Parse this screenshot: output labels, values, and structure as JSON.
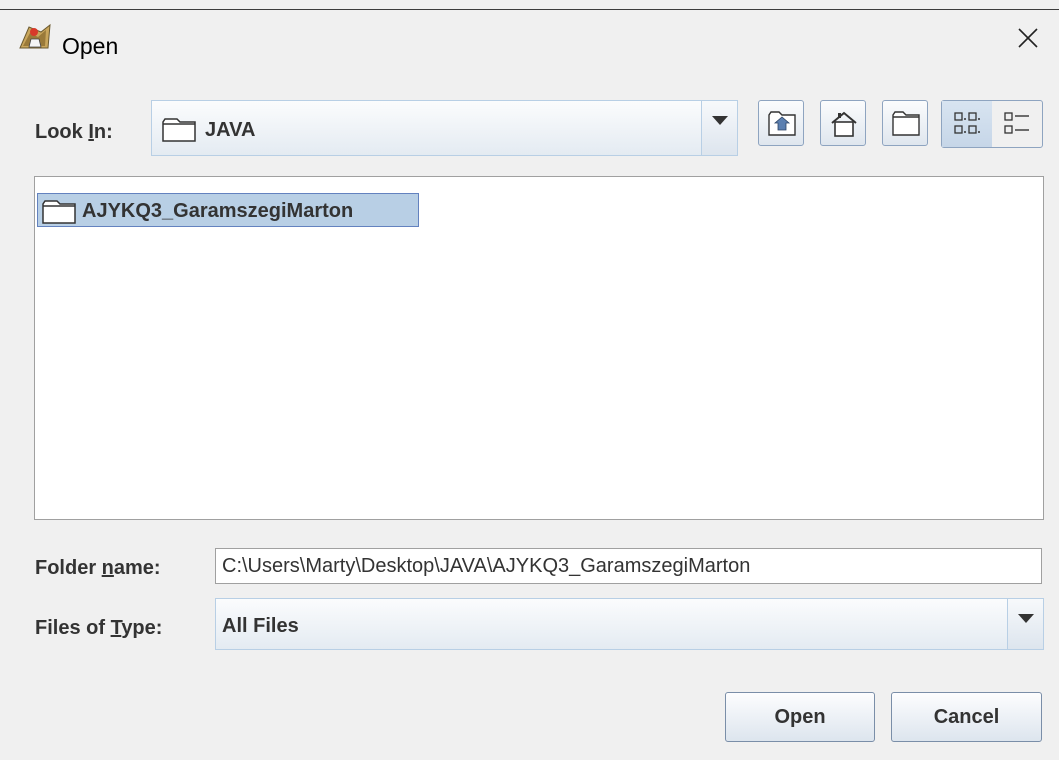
{
  "window": {
    "title": "Open",
    "app_icon": "java-duke-icon",
    "close_icon": "close-icon"
  },
  "look_in": {
    "label_pre": "Look ",
    "label_mnemonic": "I",
    "label_post": "n:",
    "value": "JAVA",
    "value_icon": "folder-icon"
  },
  "toolbar": {
    "buttons": [
      {
        "name": "up-one-level",
        "icon": "up-folder-icon"
      },
      {
        "name": "home",
        "icon": "home-icon"
      },
      {
        "name": "new-folder",
        "icon": "new-folder-icon"
      }
    ],
    "view_modes": [
      {
        "name": "list-view",
        "icon": "list-view-icon",
        "selected": true
      },
      {
        "name": "details-view",
        "icon": "details-view-icon",
        "selected": false
      }
    ]
  },
  "files": [
    {
      "name": "AJYKQ3_GaramszegiMarton",
      "icon": "folder-icon",
      "selected": true
    }
  ],
  "folder_name": {
    "label_pre": "Folder ",
    "label_mnemonic": "n",
    "label_post": "ame:",
    "value": "C:\\Users\\Marty\\Desktop\\JAVA\\AJYKQ3_GaramszegiMarton"
  },
  "files_of_type": {
    "label_pre": "Files of ",
    "label_mnemonic": "T",
    "label_post": "ype:",
    "value": "All Files"
  },
  "buttons": {
    "open": "Open",
    "cancel": "Cancel"
  },
  "colors": {
    "background": "#f0f0f0",
    "selection": "#b8cfe5",
    "selection_border": "#6382bf",
    "label_text": "#333333"
  }
}
